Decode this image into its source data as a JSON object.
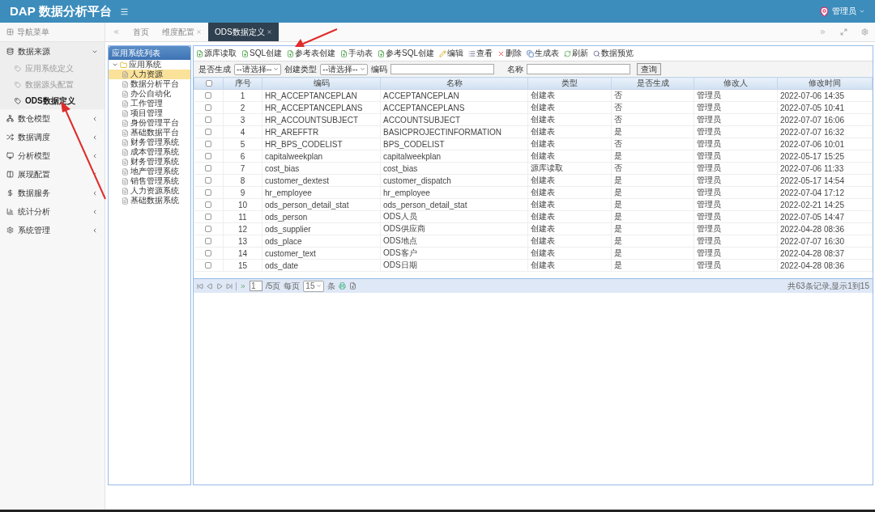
{
  "header": {
    "title": "DAP 数据分析平台",
    "user": "管理员"
  },
  "nav": {
    "title": "导航菜单",
    "items": [
      {
        "label": "数据来源",
        "expanded": true,
        "children": [
          {
            "label": "应用系统定义",
            "selected": false
          },
          {
            "label": "数据源头配置",
            "selected": false
          },
          {
            "label": "ODS数据定义",
            "selected": true
          }
        ]
      },
      {
        "label": "数仓模型",
        "expanded": false
      },
      {
        "label": "数据调度",
        "expanded": false
      },
      {
        "label": "分析模型",
        "expanded": false
      },
      {
        "label": "展现配置",
        "expanded": false
      },
      {
        "label": "数据服务",
        "expanded": false
      },
      {
        "label": "统计分析",
        "expanded": false
      },
      {
        "label": "系统管理",
        "expanded": false
      }
    ]
  },
  "tabs": [
    {
      "label": "首页",
      "closable": false,
      "selected": false
    },
    {
      "label": "维度配置",
      "closable": true,
      "selected": false
    },
    {
      "label": "ODS数据定义",
      "closable": true,
      "selected": true
    }
  ],
  "tree": {
    "title": "应用系统列表",
    "root": {
      "label": "应用系统",
      "expanded": true,
      "children": [
        {
          "label": "人力资源",
          "selected": true
        },
        {
          "label": "数据分析平台",
          "selected": false
        },
        {
          "label": "办公自动化",
          "selected": false
        },
        {
          "label": "工作管理",
          "selected": false
        },
        {
          "label": "项目管理",
          "selected": false
        },
        {
          "label": "身份管理平台",
          "selected": false
        },
        {
          "label": "基础数据平台",
          "selected": false
        },
        {
          "label": "财务管理系统",
          "selected": false
        },
        {
          "label": "成本管理系统",
          "selected": false
        },
        {
          "label": "财务管理系统",
          "selected": false
        },
        {
          "label": "地产管理系统",
          "selected": false
        },
        {
          "label": "销售管理系统",
          "selected": false
        },
        {
          "label": "人力资源系统",
          "selected": false
        },
        {
          "label": "基础数据系统",
          "selected": false
        }
      ]
    }
  },
  "toolbar": [
    {
      "label": "源库读取",
      "kind": "add"
    },
    {
      "label": "SQL创建",
      "kind": "add"
    },
    {
      "label": "参考表创建",
      "kind": "add"
    },
    {
      "label": "手动表",
      "kind": "add"
    },
    {
      "label": "参考SQL创建",
      "kind": "add"
    },
    {
      "label": "编辑",
      "kind": "edit"
    },
    {
      "label": "查看",
      "kind": "view"
    },
    {
      "label": "删除",
      "kind": "delete"
    },
    {
      "label": "生成表",
      "kind": "generate"
    },
    {
      "label": "刷新",
      "kind": "refresh"
    },
    {
      "label": "数据预览",
      "kind": "preview"
    }
  ],
  "filters": [
    {
      "label": "是否生成",
      "kind": "select",
      "value": "--请选择--"
    },
    {
      "label": "创建类型",
      "kind": "select",
      "value": "--请选择--"
    },
    {
      "label": "编码",
      "kind": "text"
    },
    {
      "label": "名称",
      "kind": "text"
    }
  ],
  "search_button": "查询",
  "table": {
    "all_checked": false,
    "columns": [
      "序号",
      "编码",
      "名称",
      "类型",
      "是否生成",
      "修改人",
      "修改时间"
    ],
    "rows": [
      {
        "checked": false,
        "cells": [
          "1",
          "HR_ACCEPTANCEPLAN",
          "ACCEPTANCEPLAN",
          "创建表",
          "否",
          "管理员",
          "2022-07-06 14:35"
        ]
      },
      {
        "checked": false,
        "cells": [
          "2",
          "HR_ACCEPTANCEPLANS",
          "ACCEPTANCEPLANS",
          "创建表",
          "否",
          "管理员",
          "2022-07-05 10:41"
        ]
      },
      {
        "checked": false,
        "cells": [
          "3",
          "HR_ACCOUNTSUBJECT",
          "ACCOUNTSUBJECT",
          "创建表",
          "否",
          "管理员",
          "2022-07-07 16:06"
        ]
      },
      {
        "checked": false,
        "cells": [
          "4",
          "HR_AREFFTR",
          "BASICPROJECTINFORMATION",
          "创建表",
          "是",
          "管理员",
          "2022-07-07 16:32"
        ]
      },
      {
        "checked": false,
        "cells": [
          "5",
          "HR_BPS_CODELIST",
          "BPS_CODELIST",
          "创建表",
          "否",
          "管理员",
          "2022-07-06 10:01"
        ]
      },
      {
        "checked": false,
        "cells": [
          "6",
          "capitalweekplan",
          "capitalweekplan",
          "创建表",
          "是",
          "管理员",
          "2022-05-17 15:25"
        ]
      },
      {
        "checked": false,
        "cells": [
          "7",
          "cost_bias",
          "cost_bias",
          "源库读取",
          "否",
          "管理员",
          "2022-07-06 11:33"
        ]
      },
      {
        "checked": false,
        "cells": [
          "8",
          "customer_dextest",
          "customer_dispatch",
          "创建表",
          "是",
          "管理员",
          "2022-05-17 14:54"
        ]
      },
      {
        "checked": false,
        "cells": [
          "9",
          "hr_employee",
          "hr_employee",
          "创建表",
          "是",
          "管理员",
          "2022-07-04 17:12"
        ]
      },
      {
        "checked": false,
        "cells": [
          "10",
          "ods_person_detail_stat",
          "ods_person_detail_stat",
          "创建表",
          "是",
          "管理员",
          "2022-02-21 14:25"
        ]
      },
      {
        "checked": false,
        "cells": [
          "11",
          "ods_person",
          "ODS人员",
          "创建表",
          "是",
          "管理员",
          "2022-07-05 14:47"
        ]
      },
      {
        "checked": false,
        "cells": [
          "12",
          "ods_supplier",
          "ODS供应商",
          "创建表",
          "是",
          "管理员",
          "2022-04-28 08:36"
        ]
      },
      {
        "checked": false,
        "cells": [
          "13",
          "ods_place",
          "ODS地点",
          "创建表",
          "是",
          "管理员",
          "2022-07-07 16:30"
        ]
      },
      {
        "checked": false,
        "cells": [
          "14",
          "customer_text",
          "ODS客户",
          "创建表",
          "是",
          "管理员",
          "2022-04-28 08:37"
        ]
      },
      {
        "checked": false,
        "cells": [
          "15",
          "ods_date",
          "ODS日期",
          "创建表",
          "是",
          "管理员",
          "2022-04-28 08:36"
        ]
      }
    ]
  },
  "pager": {
    "page": "1",
    "total_pages": "/5页",
    "per_page_label": "每页",
    "per_page": "15",
    "unit": "条",
    "summary": "共63条记录,显示1到15"
  }
}
